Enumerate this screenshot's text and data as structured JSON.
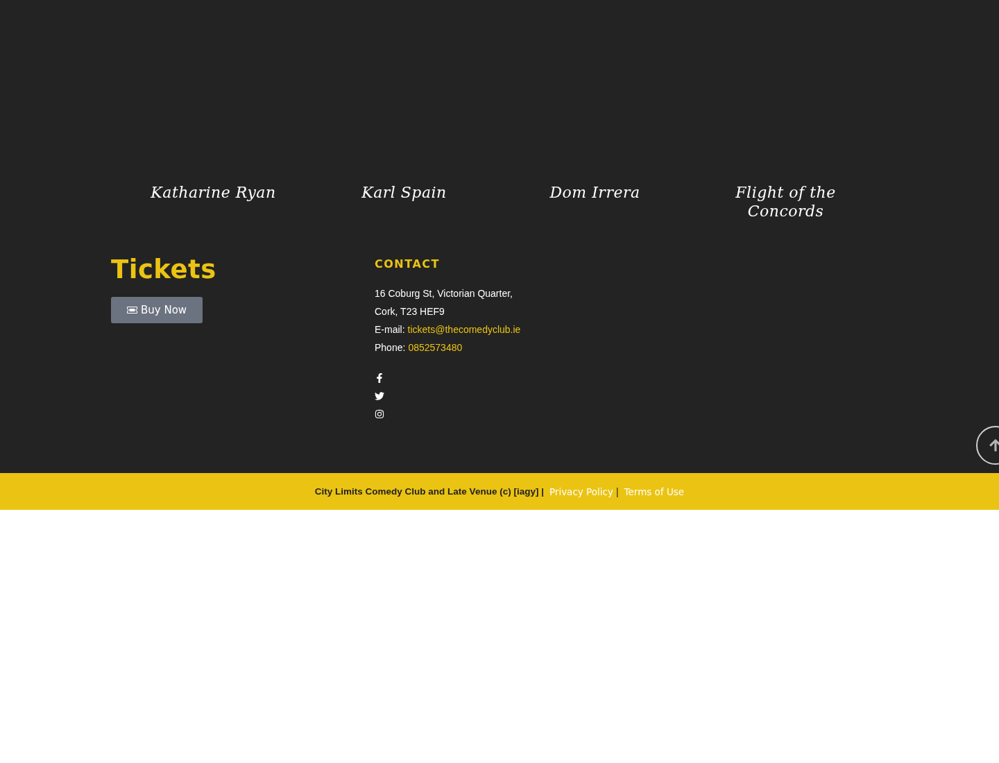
{
  "comedians": [
    {
      "name": "Katharine Ryan"
    },
    {
      "name": "Karl Spain"
    },
    {
      "name": "Dom Irrera"
    },
    {
      "name": "Flight of the Concords"
    }
  ],
  "tickets": {
    "title": "Tickets",
    "button": "Buy Now"
  },
  "contact": {
    "title": "CONTACT",
    "address": [
      "16 Coburg St, Victorian Quarter,",
      "Cork, T23 HEF9"
    ],
    "details": [
      {
        "label": "E-mail:",
        "value": "tickets@thecomedyclub.ie"
      },
      {
        "label": "Phone:",
        "value": "0852573480"
      }
    ],
    "social": [
      {
        "kind": "facebook"
      },
      {
        "kind": "twitter"
      },
      {
        "kind": "instagram"
      }
    ]
  },
  "footer": {
    "copyright": "City Limits Comedy Club and Late Venue (c) [iagy] |",
    "links": [
      {
        "label": "Privacy Policy"
      },
      {
        "label": "Terms of Use"
      }
    ],
    "separator": "|"
  }
}
